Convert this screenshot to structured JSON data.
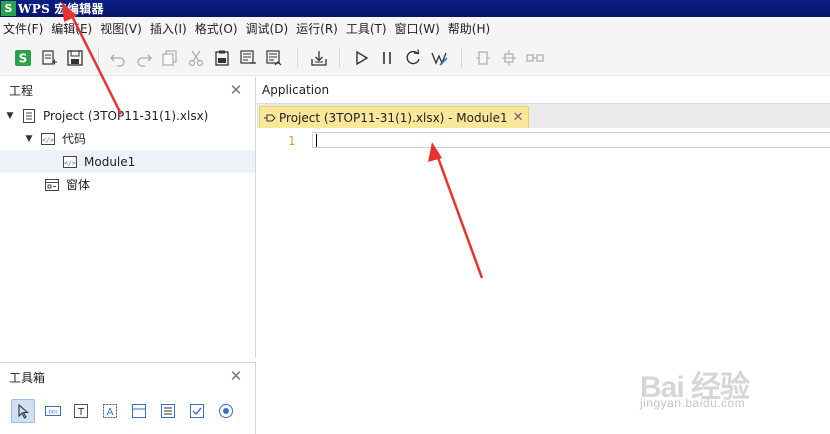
{
  "window": {
    "logo_letter": "S",
    "title": "WPS 宏编辑器"
  },
  "menu": [
    "文件(F)",
    "编辑(E)",
    "视图(V)",
    "插入(I)",
    "格式(O)",
    "调试(D)",
    "运行(R)",
    "工具(T)",
    "窗口(W)",
    "帮助(H)"
  ],
  "project_panel": {
    "title": "工程",
    "close_glyph": "✕",
    "tree": {
      "project": "Project (3TOP11-31(1).xlsx)",
      "code_folder": "代码",
      "module": "Module1",
      "form_folder": "窗体"
    }
  },
  "toolbox_panel": {
    "title": "工具箱",
    "close_glyph": "✕"
  },
  "editor": {
    "object_label": "Application",
    "tab_label": "Project (3TOP11-31(1).xlsx) - Module1",
    "tab_close_glyph": "✕",
    "line_number": "1",
    "code": ""
  },
  "watermark": {
    "main": "Bai 经验",
    "sub": "jingyan.baidu.com"
  },
  "colors": {
    "titlebar": "#0b1f86",
    "logo_green": "#2aa24a",
    "tab_yellow": "#fbe79a",
    "line_number": "#d9a21b",
    "annotation_red": "#e8322e"
  },
  "icons": {
    "toolbar": [
      "wps-s-icon",
      "new-module-icon",
      "save-icon",
      "undo-icon",
      "redo-icon",
      "copy-icon",
      "cut-icon",
      "paste-icon",
      "find-icon",
      "replace-icon",
      "import-icon",
      "run-icon",
      "pause-icon",
      "reset-icon",
      "design-mode-icon",
      "step-into-icon",
      "step-over-icon",
      "step-out-icon"
    ],
    "toolbox": [
      "pointer-icon",
      "button-icon",
      "textbox-icon",
      "label-icon",
      "frame-icon",
      "listbox-icon",
      "checkbox-icon",
      "radio-icon"
    ]
  }
}
